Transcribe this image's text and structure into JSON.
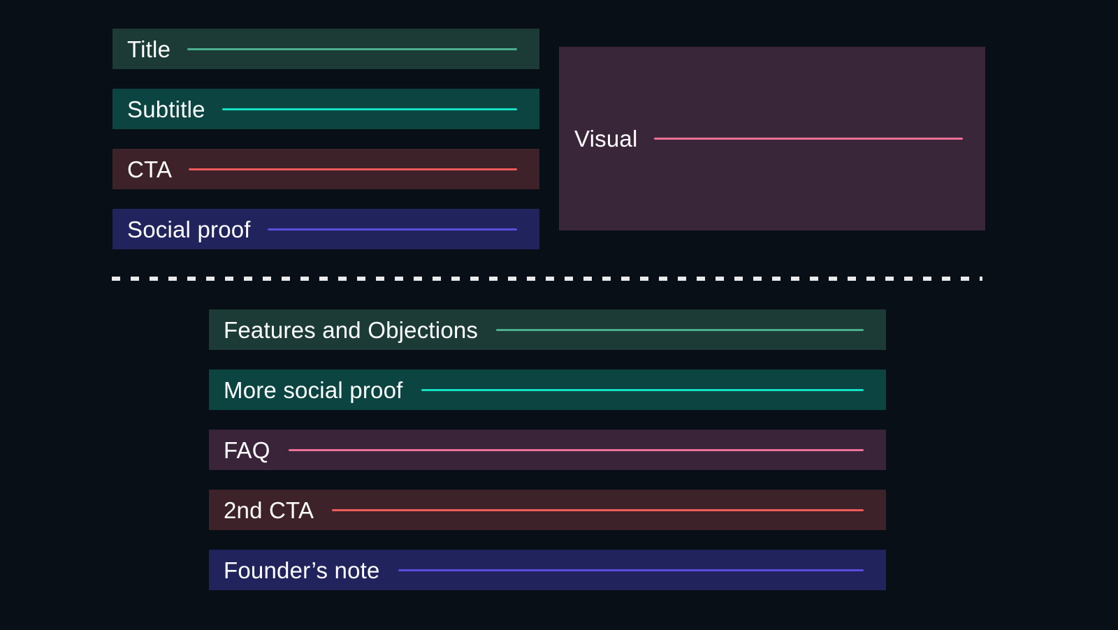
{
  "page": {
    "background_color": "#080f16",
    "title": "Landing page section wireframe"
  },
  "hero": {
    "blocks": [
      {
        "label": "Title",
        "block_color": "#1c3b36",
        "rule_color": "#4caf8c",
        "icon": "horizontal-rule-icon"
      },
      {
        "label": "Subtitle",
        "block_color": "#0b4441",
        "rule_color": "#14e0c4",
        "icon": "horizontal-rule-icon"
      },
      {
        "label": "CTA",
        "block_color": "#3d2229",
        "rule_color": "#f05a5a",
        "icon": "horizontal-rule-icon"
      },
      {
        "label": "Social proof",
        "block_color": "#21235c",
        "rule_color": "#5b4de0",
        "icon": "horizontal-rule-icon"
      }
    ]
  },
  "visual": {
    "label": "Visual",
    "block_color": "#3a2639",
    "rule_color": "#ee7096",
    "icon": "horizontal-rule-icon"
  },
  "divider": {
    "style": "dashed",
    "color": "#e8eaec",
    "name": "section-divider"
  },
  "body": {
    "blocks": [
      {
        "label": "Features and Objections",
        "block_color": "#1c3b36",
        "rule_color": "#4caf8c",
        "icon": "horizontal-rule-icon"
      },
      {
        "label": "More social proof",
        "block_color": "#0b4441",
        "rule_color": "#14e0c4",
        "icon": "horizontal-rule-icon"
      },
      {
        "label": "FAQ",
        "block_color": "#39243a",
        "rule_color": "#ee7096",
        "icon": "horizontal-rule-icon"
      },
      {
        "label": "2nd CTA",
        "block_color": "#3d2229",
        "rule_color": "#f05a5a",
        "icon": "horizontal-rule-icon"
      },
      {
        "label": "Founder’s note",
        "block_color": "#21235c",
        "rule_color": "#5b4de0",
        "icon": "horizontal-rule-icon"
      }
    ]
  }
}
